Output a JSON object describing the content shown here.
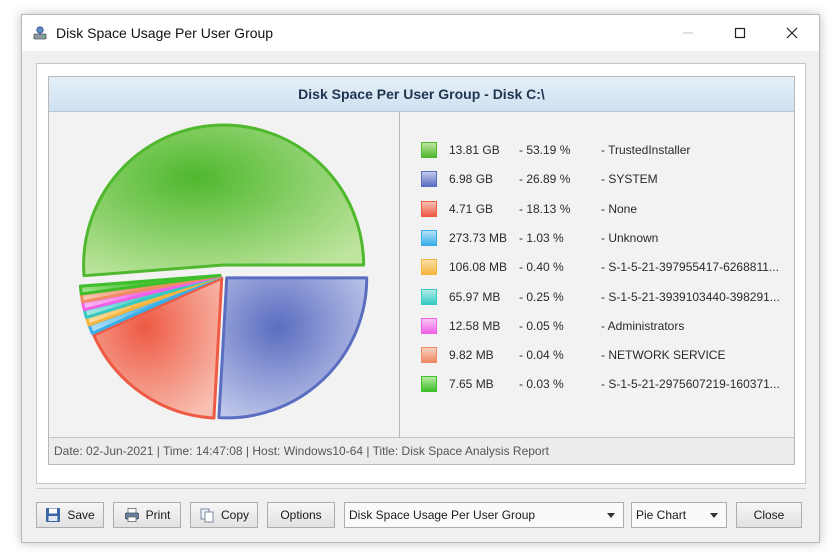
{
  "window": {
    "title": "Disk Space Usage Per User Group",
    "icon": "disk-analyzer-icon"
  },
  "chart": {
    "header": "Disk Space Per User Group - Disk C:\\",
    "footer": "Date: 02-Jun-2021 | Time: 14:47:08 | Host: Windows10-64 | Title: Disk Space Analysis Report"
  },
  "chart_data": {
    "type": "pie",
    "title": "Disk Space Per User Group - Disk C:\\",
    "legend_position": "right",
    "slices": [
      {
        "size": "13.81 GB",
        "percent_label": "- 53.19 %",
        "name": "- TrustedInstaller",
        "value": 53.19,
        "color": "#4fb82e",
        "fill": "#bfe59f"
      },
      {
        "size": "6.98 GB",
        "percent_label": "- 26.89 %",
        "name": "- SYSTEM",
        "value": 26.89,
        "color": "#5a6dc0",
        "fill": "#c4cbec"
      },
      {
        "size": "4.71 GB",
        "percent_label": "- 18.13 %",
        "name": "- None",
        "value": 18.13,
        "color": "#ee5a44",
        "fill": "#f8c0b2"
      },
      {
        "size": "273.73 MB",
        "percent_label": "- 1.03 %",
        "name": "- Unknown",
        "value": 1.03,
        "color": "#3aaee8",
        "fill": "#b7e2f7"
      },
      {
        "size": "106.08 MB",
        "percent_label": "- 0.40 %",
        "name": "- S-1-5-21-397955417-6268811...",
        "value": 0.4,
        "color": "#f5b53e",
        "fill": "#fbe0a8"
      },
      {
        "size": "65.97 MB",
        "percent_label": "- 0.25 %",
        "name": "- S-1-5-21-3939103440-398291...",
        "value": 0.25,
        "color": "#36c9c2",
        "fill": "#b1ece8"
      },
      {
        "size": "12.58 MB",
        "percent_label": "- 0.05 %",
        "name": "- Administrators",
        "value": 0.05,
        "color": "#ef62e6",
        "fill": "#f9c4f5"
      },
      {
        "size": "9.82 MB",
        "percent_label": "- 0.04 %",
        "name": "- NETWORK SERVICE",
        "value": 0.04,
        "color": "#ef8a62",
        "fill": "#f9d1bf"
      },
      {
        "size": "7.65 MB",
        "percent_label": "- 0.03 %",
        "name": "- S-1-5-21-2975607219-160371...",
        "value": 0.03,
        "color": "#3fbf2c",
        "fill": "#b7ea9f"
      }
    ]
  },
  "toolbar": {
    "save_label": "Save",
    "print_label": "Print",
    "copy_label": "Copy",
    "options_label": "Options",
    "report_select_value": "Disk Space Usage Per User Group",
    "chart_type_value": "Pie Chart",
    "close_label": "Close"
  }
}
